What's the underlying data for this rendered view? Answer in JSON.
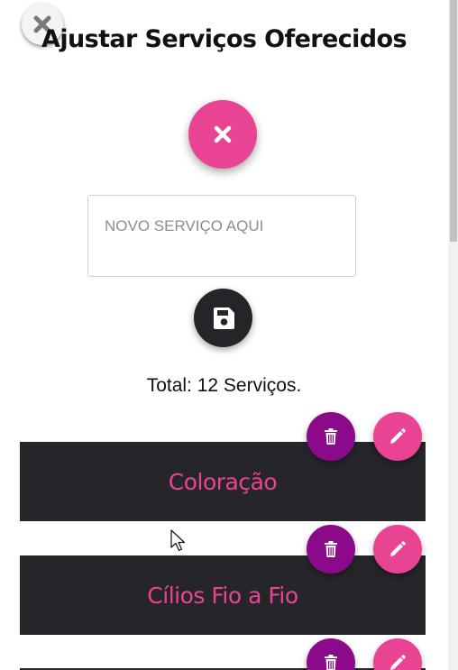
{
  "modal": {
    "title": "Ajustar Serviços Oferecidos",
    "close_icon": "close-icon",
    "cancel_icon": "close-icon",
    "save_icon": "floppy-disk-icon"
  },
  "new_service": {
    "placeholder": "NOVO SERVIÇO AQUI",
    "value": ""
  },
  "total_text": "Total: 12 Serviços.",
  "services": [
    {
      "name": "Coloração"
    },
    {
      "name": "Cílios Fio a Fio"
    },
    {
      "name": ""
    }
  ],
  "icons": {
    "delete": "trash-icon",
    "edit": "pencil-icon"
  },
  "colors": {
    "accent_pink": "#e94394",
    "delete_purple": "#8b0a8a",
    "card_dark": "#26262a",
    "save_dark": "#252529"
  }
}
